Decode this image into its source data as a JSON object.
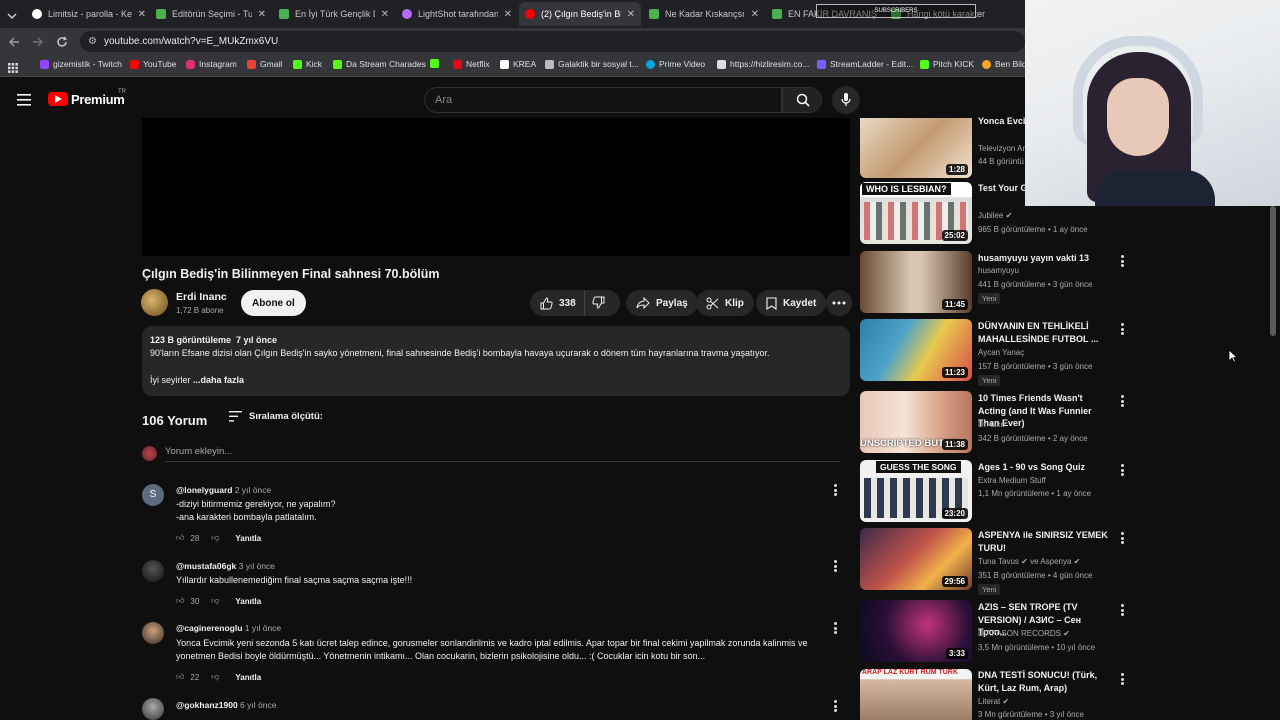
{
  "browser": {
    "tabs": [
      {
        "label": "Limitsiz - parolla - Ke",
        "active": false
      },
      {
        "label": "Editörün Seçimi - Tur",
        "active": false
      },
      {
        "label": "En İyi Türk Gençlik Di",
        "active": false
      },
      {
        "label": "LightShot tarafından",
        "active": false
      },
      {
        "label": "(2) Çılgın Bediş'in Bil",
        "active": true
      },
      {
        "label": "Ne Kadar Kıskançsın",
        "active": false
      },
      {
        "label": "EN FAKİR DAVRANIŞ",
        "active": false
      },
      {
        "label": "Hangi kötü karakter",
        "active": false
      }
    ],
    "url": "youtube.com/watch?v=E_MUkZmx6VU",
    "bookmarks": [
      {
        "label": "gizemistik - Twitch",
        "color": "#9146ff"
      },
      {
        "label": "YouTube",
        "color": "#ff0000"
      },
      {
        "label": "Instagram",
        "color": "#e1306c"
      },
      {
        "label": "Gmail",
        "color": "#ea4335"
      },
      {
        "label": "Kick",
        "color": "#53fc18"
      },
      {
        "label": "Da Stream Charades",
        "color": "#53fc18"
      },
      {
        "label": "",
        "color": "#53fc18"
      },
      {
        "label": "Netflix",
        "color": "#e50914"
      },
      {
        "label": "KREA",
        "color": "#ffffff"
      },
      {
        "label": "Galaktik bir sosyal t...",
        "color": "#bbbbbb"
      },
      {
        "label": "Prime Video",
        "color": "#00a8e1"
      },
      {
        "label": "https://hizliresim.co...",
        "color": "#dddddd"
      },
      {
        "label": "StreamLadder - Edit...",
        "color": "#7c5cff"
      },
      {
        "label": "Pitch KICK",
        "color": "#53fc18"
      },
      {
        "label": "Ben Bildi",
        "color": "#f5a623"
      }
    ]
  },
  "header": {
    "logo_text": "Premium",
    "logo_sup": "TR",
    "search_placeholder": "Ara"
  },
  "video": {
    "title": "Çılgın Bediş'in Bilinmeyen Final sahnesi 70.bölüm",
    "channel": "Erdi Inanc",
    "subscribers": "1,72 B abone",
    "subscribe_label": "Abone ol",
    "likes": "338",
    "share_label": "Paylaş",
    "clip_label": "Klip",
    "save_label": "Kaydet",
    "views_date": "123 B görüntüleme  7 yıl önce",
    "description": "90'ların Efsane dizisi olan Çılgın Bediş'in sayko yönetmeni, final sahnesinde Bediş'i bombayla havaya uçurarak o dönem tüm hayranlarına travma yaşatıyor.",
    "desc_preview": "İyi seyirler",
    "more_label": "...daha fazla"
  },
  "comments_section": {
    "count_label": "106 Yorum",
    "sort_label": "Sıralama ölçütü:",
    "add_placeholder": "Yorum ekleyin...",
    "reply_label": "Yanıtla",
    "comments": [
      {
        "author": "@lonelyguard",
        "time": "2 yıl önce",
        "text": "-diziyi bitirmemiz gerekiyor, ne yapalım?\n-ana karakteri bombayla patlatalım.",
        "likes": "28"
      },
      {
        "author": "@mustafa06gk",
        "time": "3 yıl önce",
        "text": "Yıllardır kabullenemediğim final saçma saçma saçma işte!!!",
        "likes": "30"
      },
      {
        "author": "@caginerenoglu",
        "time": "1 yıl önce",
        "text": "Yonca Evcimik yeni sezonda 5 katı ücret talep edince, gorusmeler sonlandirilmis ve kadro iptal edilmis. Apar topar bir final cekimi yapilmak zorunda kalinmis ve yonetmen Bedisi boyle öldürmüştü... Yönetmenin intikamı... Olan cocukarin, bizlerin psikolojisine oldu... :( Cocuklar icin kotu bir son...",
        "likes": "22"
      },
      {
        "author": "@gokhanz1900",
        "time": "6 yıl önce",
        "text": "",
        "likes": ""
      }
    ]
  },
  "sidebar": {
    "items": [
      {
        "title": "Yonca Evcimik nasıl bitirdi",
        "channel": "Televizyon Ar",
        "meta": "44 B görüntü",
        "duration": "1:28",
        "badge": ""
      },
      {
        "title": "Test Your G (Pt. 2)",
        "channel": "Jubilee",
        "meta": "965 B görüntüleme • 1 ay önce",
        "duration": "25:02",
        "badge": "",
        "thumb_text": "WHO IS LESBIAN?"
      },
      {
        "title": "husamyuyu yayın vakti 13",
        "channel": "husamyuyu",
        "meta": "441 B görüntüleme • 3 gün önce",
        "duration": "11:45",
        "badge": "Yeni"
      },
      {
        "title": "DÜNYANIN EN TEHLİKELİ MAHALLESİNDE FUTBOL ...",
        "channel": "Aycan Yanaç",
        "meta": "157 B görüntüleme • 3 gün önce",
        "duration": "11:23",
        "badge": "Yeni"
      },
      {
        "title": "10 Times Friends Wasn't Acting (and It Was Funnier Than Ever)",
        "channel": "Dr. Liko",
        "meta": "342 B görüntüleme • 2 ay önce",
        "duration": "11:38",
        "badge": "",
        "thumb_text": "UNSCRIPTED BUT PE"
      },
      {
        "title": "Ages 1 - 90 vs Song Quiz",
        "channel": "Extra Medium Stuff",
        "meta": "1,1 Mn görüntüleme • 1 ay önce",
        "duration": "23:20",
        "badge": "",
        "thumb_text": "GUESS THE SONG"
      },
      {
        "title": "ASPENYA ile SINIRSIZ YEMEK TURU!",
        "channel": "Tuna Tavus ✔ ve Aspenya ✔",
        "meta": "351 B görüntüleme • 4 gün önce",
        "duration": "29:56",
        "badge": "Yeni"
      },
      {
        "title": "AZIS – SEN TROPE (TV VERSION) / АЗИС – Сен Троп...",
        "channel": "DIAPASON RECORDS ✔",
        "meta": "3,5 Mn görüntüleme • 10 yıl önce",
        "duration": "3:33",
        "badge": ""
      },
      {
        "title": "DNA TESTİ SONUCU! (Türk, Kürt, Laz Rum, Arap)",
        "channel": "Literat ✔",
        "meta": "3 Mn görüntüleme • 3 yıl önce",
        "duration": "",
        "badge": "",
        "thumb_text": "ARAP LAZ KÜRT RUM TÜRK"
      }
    ]
  },
  "overlay": {
    "webcam_label": "SUBSCRIBERS"
  }
}
